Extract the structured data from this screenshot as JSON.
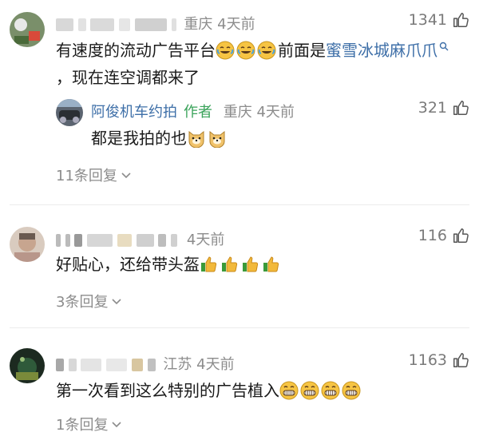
{
  "comments": [
    {
      "location": "重庆",
      "time": "4天前",
      "likes": "1341",
      "text_part1": "有速度的流动广告平台",
      "text_part2": "前面是",
      "link_text": "蜜雪冰城麻爪爪",
      "text_line2": "，现在连空调都来了",
      "reply": {
        "author": "阿俊机车约拍",
        "author_tag": "作者",
        "location": "重庆",
        "time": "4天前",
        "likes": "321",
        "text": "都是我拍的也"
      },
      "replies_label": "11条回复"
    },
    {
      "time": "4天前",
      "likes": "116",
      "text": "好贴心，还给带头盔",
      "replies_label": "3条回复"
    },
    {
      "location_partial": "江苏",
      "time": "4天前",
      "likes": "1163",
      "text": "第一次看到这么特别的广告植入",
      "replies_label": "1条回复"
    }
  ],
  "icons": {
    "like": "thumbs-up-outline-icon",
    "search": "search-icon",
    "expand": "chevron-down-icon",
    "emoji_laugh_cry": "face-with-tears-of-joy",
    "emoji_dog": "doge-face",
    "emoji_thumbs": "thumbs-up-emoji",
    "emoji_grin": "grinning-face-emoji"
  },
  "colors": {
    "link": "#3e6fa8",
    "author_tag": "#3aa35a",
    "meta": "#8c8c8c"
  }
}
